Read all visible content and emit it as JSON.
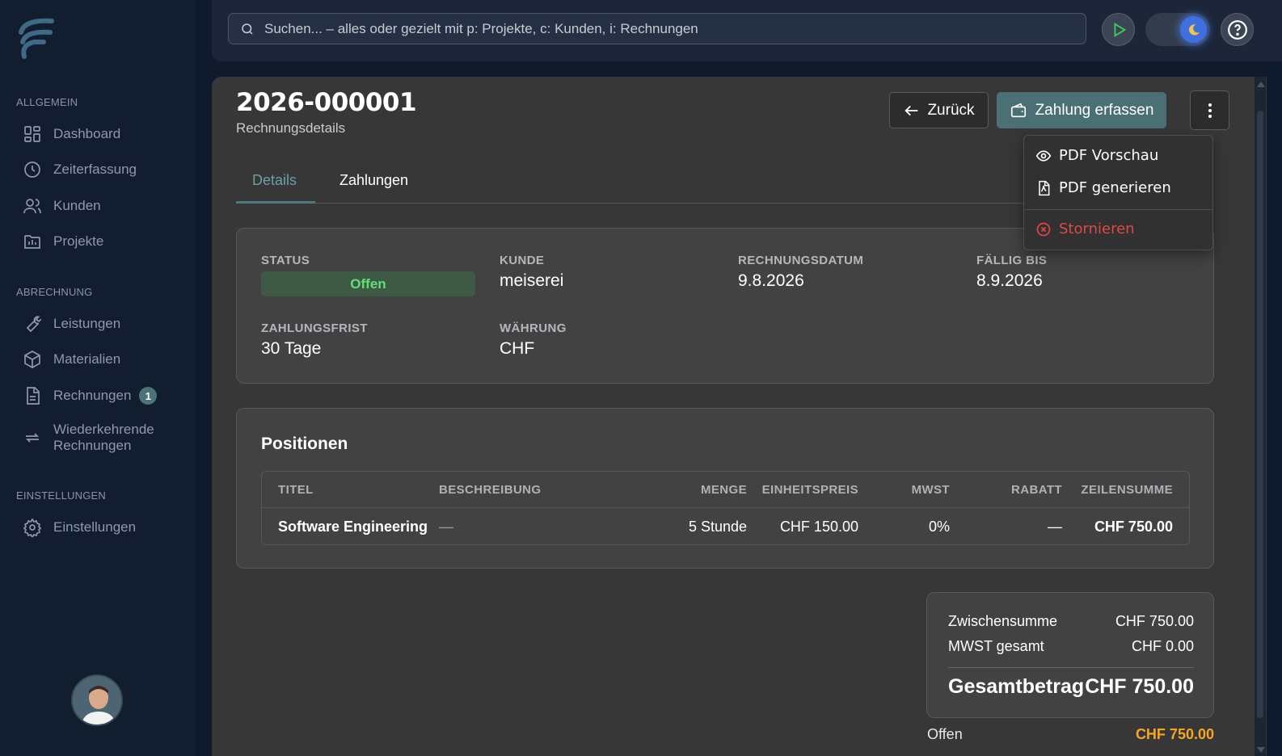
{
  "sidebar": {
    "sections": [
      {
        "label": "ALLGEMEIN"
      },
      {
        "label": "ABRECHNUNG"
      },
      {
        "label": "EINSTELLUNGEN"
      }
    ],
    "items": [
      {
        "label": "Dashboard",
        "icon": "dashboard-icon"
      },
      {
        "label": "Zeiterfassung",
        "icon": "clock-icon"
      },
      {
        "label": "Kunden",
        "icon": "users-icon"
      },
      {
        "label": "Projekte",
        "icon": "projects-icon"
      },
      {
        "label": "Leistungen",
        "icon": "wrench-icon"
      },
      {
        "label": "Materialien",
        "icon": "box-icon"
      },
      {
        "label": "Rechnungen",
        "icon": "document-icon",
        "badge": "1"
      },
      {
        "label": "Wiederkehrende Rechnungen",
        "icon": "repeat-icon"
      },
      {
        "label": "Einstellungen",
        "icon": "gear-icon"
      }
    ]
  },
  "search": {
    "placeholder": "Suchen... – alles oder gezielt mit p: Projekte, c: Kunden, i: Rechnungen"
  },
  "header": {
    "invoice_number": "2026-000001",
    "subtitle": "Rechnungsdetails",
    "back_label": "Zurück",
    "pay_label": "Zahlung erfassen"
  },
  "tabs": [
    {
      "label": "Details",
      "active": true
    },
    {
      "label": "Zahlungen",
      "active": false
    }
  ],
  "details": {
    "status_label": "STATUS",
    "status_value": "Offen",
    "kunde_label": "KUNDE",
    "kunde_value": "meiserei",
    "datum_label": "RECHNUNGSDATUM",
    "datum_value": "9.8.2026",
    "faellig_label": "FÄLLIG BIS",
    "faellig_value": "8.9.2026",
    "frist_label": "ZAHLUNGSFRIST",
    "frist_value": "30 Tage",
    "waehrung_label": "WÄHRUNG",
    "waehrung_value": "CHF"
  },
  "positions": {
    "title": "Positionen",
    "columns": [
      "TITEL",
      "BESCHREIBUNG",
      "MENGE",
      "EINHEITSPREIS",
      "MWST",
      "RABATT",
      "ZEILENSUMME"
    ],
    "rows": [
      [
        "Software Engineering",
        "—",
        "5 Stunde",
        "CHF 150.00",
        "0%",
        "—",
        "CHF 750.00"
      ]
    ]
  },
  "summary": {
    "subtotal_label": "Zwischensumme",
    "subtotal_value": "CHF 750.00",
    "vat_label": "MWST gesamt",
    "vat_value": "CHF 0.00",
    "total_label": "Gesamtbetrag",
    "total_value": "CHF 750.00",
    "open_label": "Offen",
    "open_value": "CHF 750.00"
  },
  "menu": {
    "items": [
      {
        "label": "PDF Vorschau",
        "icon": "eye-icon"
      },
      {
        "label": "PDF generieren",
        "icon": "pdf-file-icon"
      },
      {
        "label": "Stornieren",
        "icon": "x-circle-icon"
      }
    ]
  },
  "colors": {
    "accent": "#4a6f75",
    "status_open": "#5ee07a",
    "open_amount": "#f5a623",
    "danger": "#e04848"
  }
}
